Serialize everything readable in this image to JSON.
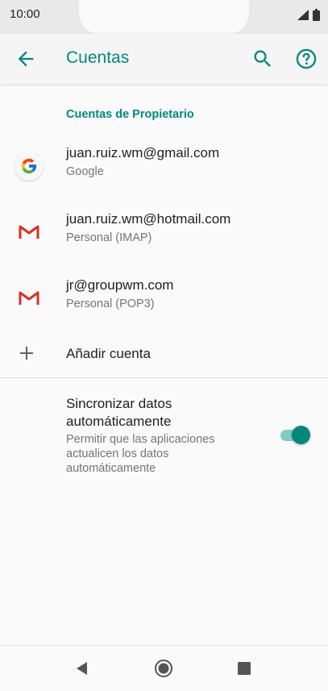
{
  "status_bar": {
    "time": "10:00"
  },
  "app_bar": {
    "title": "Cuentas"
  },
  "section": {
    "header": "Cuentas de Propietario"
  },
  "accounts": [
    {
      "name": "juan.ruiz.wm@gmail.com",
      "type": "Google",
      "icon": "google-icon"
    },
    {
      "name": "juan.ruiz.wm@hotmail.com",
      "type": "Personal (IMAP)",
      "icon": "gmail-icon"
    },
    {
      "name": "jr@groupwm.com",
      "type": "Personal (POP3)",
      "icon": "gmail-icon"
    }
  ],
  "add_account": {
    "label": "Añadir cuenta"
  },
  "sync": {
    "title": "Sincronizar datos automáticamente",
    "description": "Permitir que las aplicaciones actualicen los datos automáticamente",
    "enabled": true
  },
  "colors": {
    "accent": "#00897b",
    "accent_light": "#80cbc4"
  }
}
